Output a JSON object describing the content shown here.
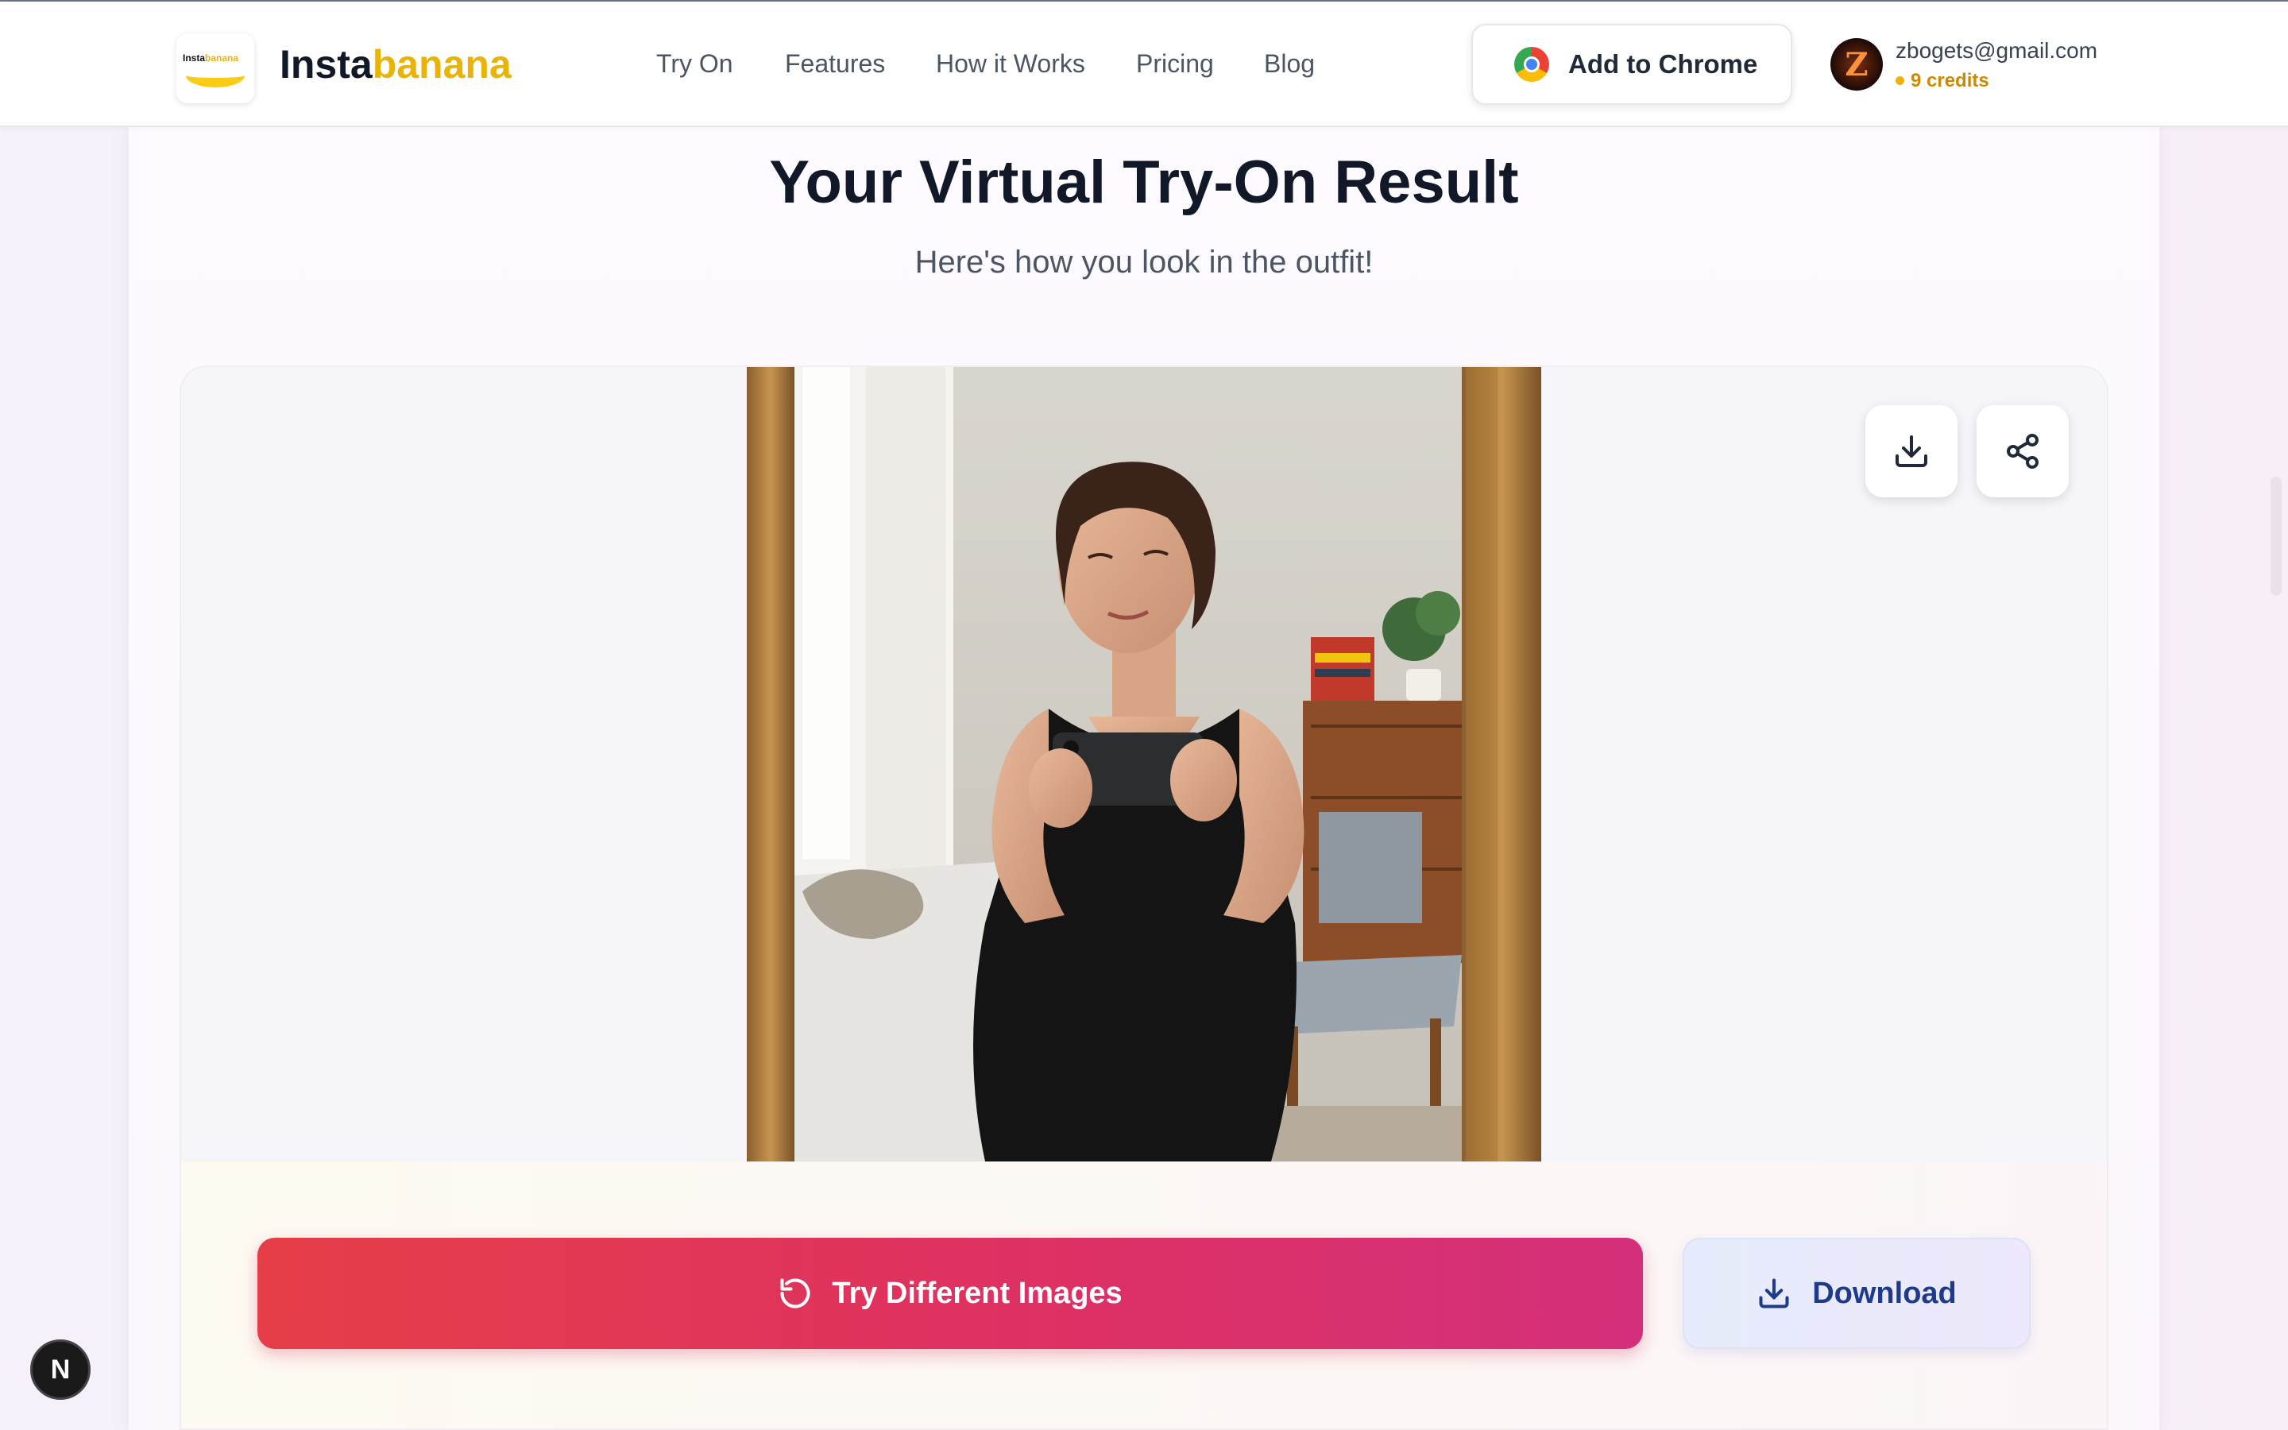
{
  "header": {
    "logo_mini_black": "Insta",
    "logo_mini_yellow": "banana",
    "brand_black": "Insta",
    "brand_yellow": "banana",
    "nav": [
      {
        "label": "Try On"
      },
      {
        "label": "Features"
      },
      {
        "label": "How it Works"
      },
      {
        "label": "Pricing"
      },
      {
        "label": "Blog"
      }
    ],
    "chrome_button": "Add to Chrome",
    "avatar_letter": "Z",
    "email": "zbogets@gmail.com",
    "credits": "9 credits"
  },
  "main": {
    "title": "Your Virtual Try-On Result",
    "subtitle": "Here's how you look in the outfit!",
    "result_image": "woman-mirror-selfie-black-dress",
    "actions": {
      "try_again": "Try Different Images",
      "download": "Download"
    },
    "icons": {
      "download": "download-icon",
      "share": "share-icon",
      "retry": "refresh-icon"
    }
  },
  "dev_badge": "N",
  "colors": {
    "brand_yellow": "#eab308",
    "primary_start": "#e63e48",
    "primary_end": "#d42f7a",
    "download_text": "#1e3a8a"
  }
}
